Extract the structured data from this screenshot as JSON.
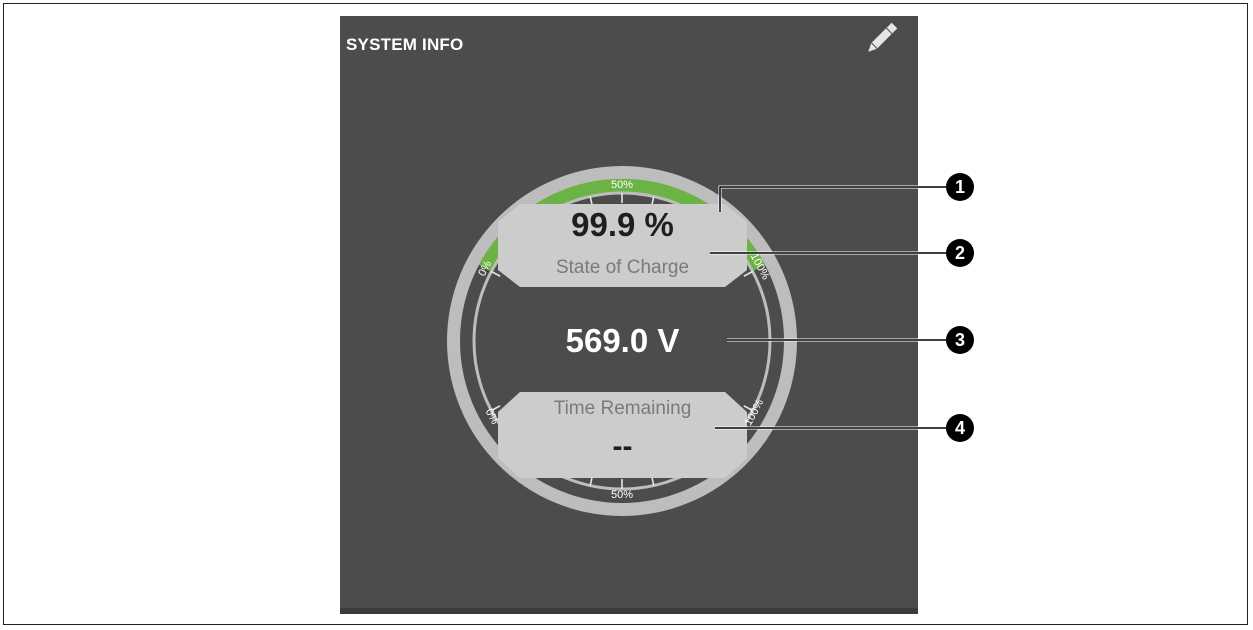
{
  "panel": {
    "title": "SYSTEM INFO",
    "edit_icon": "pencil-icon"
  },
  "gauge": {
    "state_of_charge": {
      "value": "99.9 %",
      "label": "State of Charge",
      "fill_fraction": 0.999,
      "tick_min": "0%",
      "tick_mid": "50%",
      "tick_max": "100%"
    },
    "voltage": {
      "value": "569.0 V"
    },
    "time_remaining": {
      "label": "Time Remaining",
      "value": "--",
      "tick_min": "0%",
      "tick_mid": "50%",
      "tick_max": "100%"
    }
  },
  "callouts": [
    "1",
    "2",
    "3",
    "4"
  ],
  "colors": {
    "panel_bg": "#4b4c4b",
    "ring": "#c9c9c9",
    "charge_arc": "#6ab344",
    "label_box": "#cccccc"
  }
}
